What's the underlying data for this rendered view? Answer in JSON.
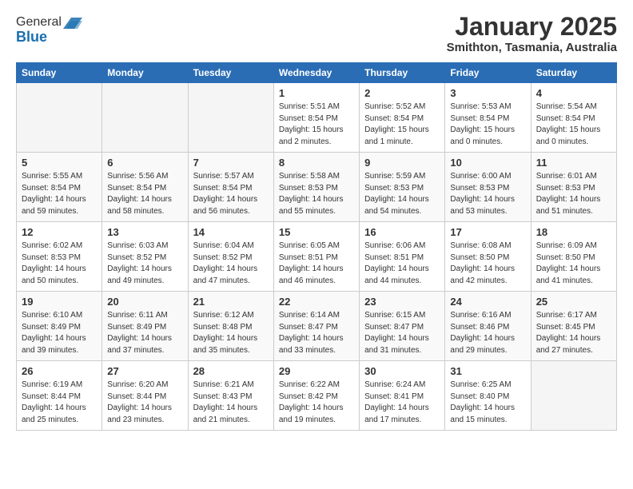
{
  "logo": {
    "general": "General",
    "blue": "Blue"
  },
  "header": {
    "title": "January 2025",
    "subtitle": "Smithton, Tasmania, Australia"
  },
  "days_of_week": [
    "Sunday",
    "Monday",
    "Tuesday",
    "Wednesday",
    "Thursday",
    "Friday",
    "Saturday"
  ],
  "weeks": [
    [
      {
        "day": "",
        "info": ""
      },
      {
        "day": "",
        "info": ""
      },
      {
        "day": "",
        "info": ""
      },
      {
        "day": "1",
        "info": "Sunrise: 5:51 AM\nSunset: 8:54 PM\nDaylight: 15 hours\nand 2 minutes."
      },
      {
        "day": "2",
        "info": "Sunrise: 5:52 AM\nSunset: 8:54 PM\nDaylight: 15 hours\nand 1 minute."
      },
      {
        "day": "3",
        "info": "Sunrise: 5:53 AM\nSunset: 8:54 PM\nDaylight: 15 hours\nand 0 minutes."
      },
      {
        "day": "4",
        "info": "Sunrise: 5:54 AM\nSunset: 8:54 PM\nDaylight: 15 hours\nand 0 minutes."
      }
    ],
    [
      {
        "day": "5",
        "info": "Sunrise: 5:55 AM\nSunset: 8:54 PM\nDaylight: 14 hours\nand 59 minutes."
      },
      {
        "day": "6",
        "info": "Sunrise: 5:56 AM\nSunset: 8:54 PM\nDaylight: 14 hours\nand 58 minutes."
      },
      {
        "day": "7",
        "info": "Sunrise: 5:57 AM\nSunset: 8:54 PM\nDaylight: 14 hours\nand 56 minutes."
      },
      {
        "day": "8",
        "info": "Sunrise: 5:58 AM\nSunset: 8:53 PM\nDaylight: 14 hours\nand 55 minutes."
      },
      {
        "day": "9",
        "info": "Sunrise: 5:59 AM\nSunset: 8:53 PM\nDaylight: 14 hours\nand 54 minutes."
      },
      {
        "day": "10",
        "info": "Sunrise: 6:00 AM\nSunset: 8:53 PM\nDaylight: 14 hours\nand 53 minutes."
      },
      {
        "day": "11",
        "info": "Sunrise: 6:01 AM\nSunset: 8:53 PM\nDaylight: 14 hours\nand 51 minutes."
      }
    ],
    [
      {
        "day": "12",
        "info": "Sunrise: 6:02 AM\nSunset: 8:53 PM\nDaylight: 14 hours\nand 50 minutes."
      },
      {
        "day": "13",
        "info": "Sunrise: 6:03 AM\nSunset: 8:52 PM\nDaylight: 14 hours\nand 49 minutes."
      },
      {
        "day": "14",
        "info": "Sunrise: 6:04 AM\nSunset: 8:52 PM\nDaylight: 14 hours\nand 47 minutes."
      },
      {
        "day": "15",
        "info": "Sunrise: 6:05 AM\nSunset: 8:51 PM\nDaylight: 14 hours\nand 46 minutes."
      },
      {
        "day": "16",
        "info": "Sunrise: 6:06 AM\nSunset: 8:51 PM\nDaylight: 14 hours\nand 44 minutes."
      },
      {
        "day": "17",
        "info": "Sunrise: 6:08 AM\nSunset: 8:50 PM\nDaylight: 14 hours\nand 42 minutes."
      },
      {
        "day": "18",
        "info": "Sunrise: 6:09 AM\nSunset: 8:50 PM\nDaylight: 14 hours\nand 41 minutes."
      }
    ],
    [
      {
        "day": "19",
        "info": "Sunrise: 6:10 AM\nSunset: 8:49 PM\nDaylight: 14 hours\nand 39 minutes."
      },
      {
        "day": "20",
        "info": "Sunrise: 6:11 AM\nSunset: 8:49 PM\nDaylight: 14 hours\nand 37 minutes."
      },
      {
        "day": "21",
        "info": "Sunrise: 6:12 AM\nSunset: 8:48 PM\nDaylight: 14 hours\nand 35 minutes."
      },
      {
        "day": "22",
        "info": "Sunrise: 6:14 AM\nSunset: 8:47 PM\nDaylight: 14 hours\nand 33 minutes."
      },
      {
        "day": "23",
        "info": "Sunrise: 6:15 AM\nSunset: 8:47 PM\nDaylight: 14 hours\nand 31 minutes."
      },
      {
        "day": "24",
        "info": "Sunrise: 6:16 AM\nSunset: 8:46 PM\nDaylight: 14 hours\nand 29 minutes."
      },
      {
        "day": "25",
        "info": "Sunrise: 6:17 AM\nSunset: 8:45 PM\nDaylight: 14 hours\nand 27 minutes."
      }
    ],
    [
      {
        "day": "26",
        "info": "Sunrise: 6:19 AM\nSunset: 8:44 PM\nDaylight: 14 hours\nand 25 minutes."
      },
      {
        "day": "27",
        "info": "Sunrise: 6:20 AM\nSunset: 8:44 PM\nDaylight: 14 hours\nand 23 minutes."
      },
      {
        "day": "28",
        "info": "Sunrise: 6:21 AM\nSunset: 8:43 PM\nDaylight: 14 hours\nand 21 minutes."
      },
      {
        "day": "29",
        "info": "Sunrise: 6:22 AM\nSunset: 8:42 PM\nDaylight: 14 hours\nand 19 minutes."
      },
      {
        "day": "30",
        "info": "Sunrise: 6:24 AM\nSunset: 8:41 PM\nDaylight: 14 hours\nand 17 minutes."
      },
      {
        "day": "31",
        "info": "Sunrise: 6:25 AM\nSunset: 8:40 PM\nDaylight: 14 hours\nand 15 minutes."
      },
      {
        "day": "",
        "info": ""
      }
    ]
  ]
}
